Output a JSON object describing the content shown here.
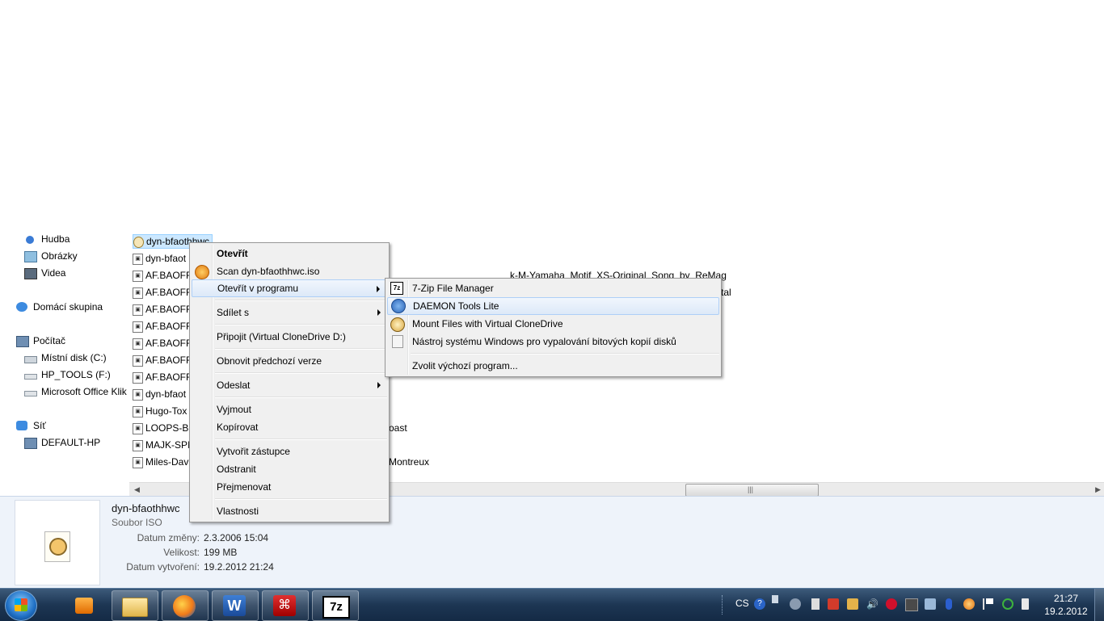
{
  "explorer": {
    "nav": [
      {
        "label": "Hudba",
        "icon": "music-icon"
      },
      {
        "label": "Obrázky",
        "icon": "pictures-icon"
      },
      {
        "label": "Videa",
        "icon": "videos-icon"
      },
      {
        "label": "Domácí skupina",
        "icon": "homegroup-icon"
      },
      {
        "label": "Počítač",
        "icon": "computer-icon"
      },
      {
        "label": "Místní disk (C:)",
        "icon": "drive-icon"
      },
      {
        "label": "HP_TOOLS (F:)",
        "icon": "drive-icon"
      },
      {
        "label": "Microsoft Office Klik",
        "icon": "drive-icon"
      },
      {
        "label": "Síť",
        "icon": "network-icon"
      },
      {
        "label": "DEFAULT-HP",
        "icon": "computer-icon"
      }
    ],
    "files": [
      "dyn-bfaothhwc",
      "dyn-bfaot",
      "AF.BAOFF",
      "AF.BAOFF",
      "AF.BAOFF",
      "AF.BAOFF",
      "AF.BAOFF",
      "AF.BAOFF",
      "AF.BAOFF",
      "dyn-bfaot",
      "Hugo-Tox",
      "LOOPS-Bi",
      "MAJK-SPI",
      "Miles-Dav"
    ],
    "partial_right": {
      "row1": "k-M-Yamaha_Motif_XS-Original_Song_by_ReMag",
      "row2": "tal",
      "row3": "oast",
      "row4": "Montreux"
    }
  },
  "context_menu": {
    "items": [
      {
        "label": "Otevřít",
        "bold": true
      },
      {
        "label": "Scan dyn-bfaothhwc.iso",
        "icon": "scan-icon"
      },
      {
        "label": "Otevřít v programu",
        "submenu": true
      },
      {
        "label": "Sdílet s",
        "submenu": true
      },
      {
        "label": "Připojit (Virtual CloneDrive D:)"
      },
      {
        "label": "Obnovit předchozí verze"
      },
      {
        "label": "Odeslat",
        "submenu": true
      },
      {
        "label": "Vyjmout"
      },
      {
        "label": "Kopírovat"
      },
      {
        "label": "Vytvořit zástupce"
      },
      {
        "label": "Odstranit"
      },
      {
        "label": "Přejmenovat"
      },
      {
        "label": "Vlastnosti"
      }
    ]
  },
  "submenu": {
    "items": [
      {
        "label": "7-Zip File Manager",
        "icon": "7zip-icon"
      },
      {
        "label": "DAEMON Tools Lite",
        "icon": "daemon-tools-icon"
      },
      {
        "label": "Mount Files with Virtual CloneDrive",
        "icon": "clonedrive-icon"
      },
      {
        "label": "Nástroj systému Windows pro vypalování bitových kopií disků",
        "icon": "disc-burner-icon"
      },
      {
        "label": "Zvolit výchozí program..."
      }
    ]
  },
  "details": {
    "name": "dyn-bfaothhwc",
    "type": "Soubor ISO",
    "modified_label": "Datum změny:",
    "modified_value": "2.3.2006 15:04",
    "size_label": "Velikost:",
    "size_value": "199 MB",
    "created_label": "Datum vytvoření:",
    "created_value": "19.2.2012 21:24"
  },
  "taskbar": {
    "language": "CS",
    "time": "21:27",
    "date": "19.2.2012",
    "pinned": [
      "media-player-icon",
      "explorer-icon",
      "firefox-icon",
      "word-icon",
      "acrobat-icon",
      "7zip-icon"
    ],
    "zip_label": "7z"
  },
  "colors": {
    "highlight": "#cce8ff",
    "taskbar": "#1d3653",
    "details_bg": "#eef3fa"
  }
}
